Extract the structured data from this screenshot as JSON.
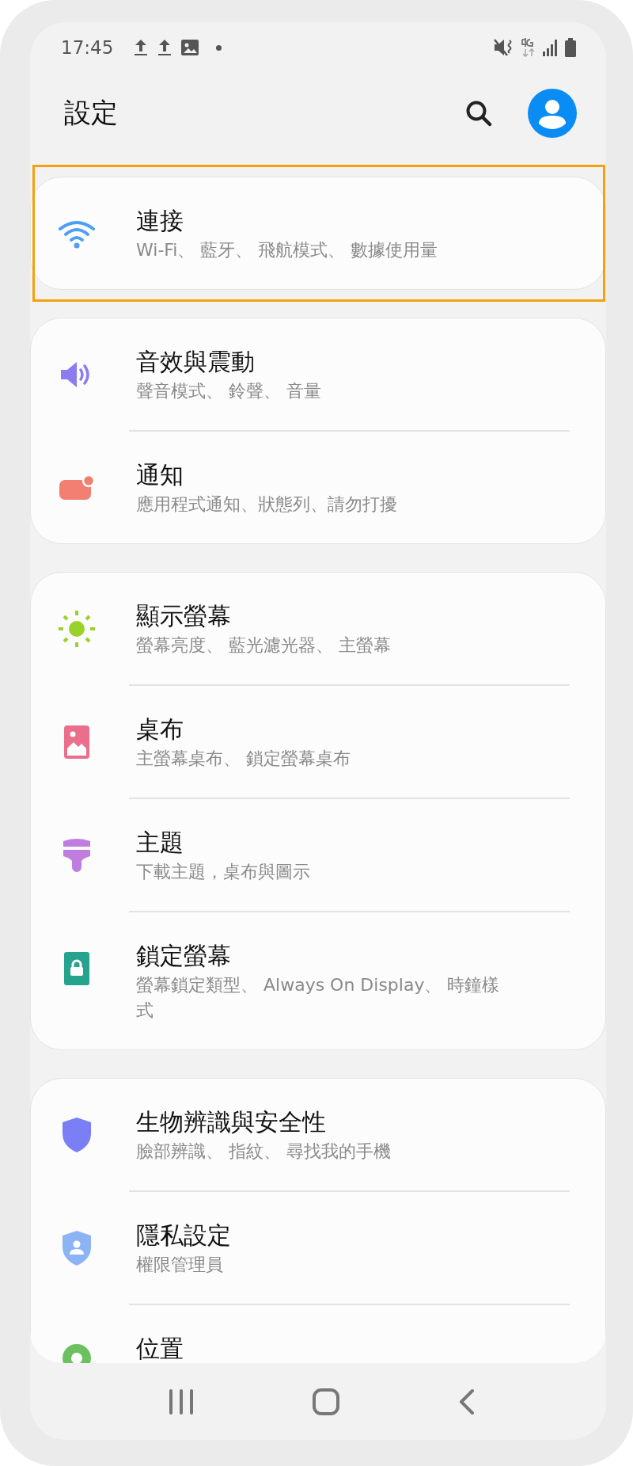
{
  "status_bar": {
    "time": "17:45"
  },
  "header": {
    "title": "設定"
  },
  "groups": [
    {
      "highlighted": true,
      "items": [
        {
          "kind": "wifi",
          "title": "連接",
          "subtitle": "Wi-Fi、 藍牙、 飛航模式、 數據使用量"
        }
      ]
    },
    {
      "highlighted": false,
      "items": [
        {
          "kind": "sound",
          "title": "音效與震動",
          "subtitle": "聲音模式、 鈴聲、 音量"
        },
        {
          "kind": "notification",
          "title": "通知",
          "subtitle": "應用程式通知、狀態列、請勿打擾"
        }
      ]
    },
    {
      "highlighted": false,
      "items": [
        {
          "kind": "display",
          "title": "顯示螢幕",
          "subtitle": "螢幕亮度、 藍光濾光器、 主螢幕"
        },
        {
          "kind": "wallpaper",
          "title": "桌布",
          "subtitle": "主螢幕桌布、 鎖定螢幕桌布"
        },
        {
          "kind": "theme",
          "title": "主題",
          "subtitle": "下載主題，桌布與圖示"
        },
        {
          "kind": "lock",
          "title": "鎖定螢幕",
          "subtitle": "螢幕鎖定類型、 Always On Display、 時鐘樣式"
        }
      ]
    },
    {
      "highlighted": false,
      "items": [
        {
          "kind": "biometrics",
          "title": "生物辨識與安全性",
          "subtitle": "臉部辨識、 指紋、 尋找我的手機"
        },
        {
          "kind": "privacy",
          "title": "隱私設定",
          "subtitle": "權限管理員"
        },
        {
          "kind": "location",
          "title": "位置"
        }
      ]
    }
  ]
}
